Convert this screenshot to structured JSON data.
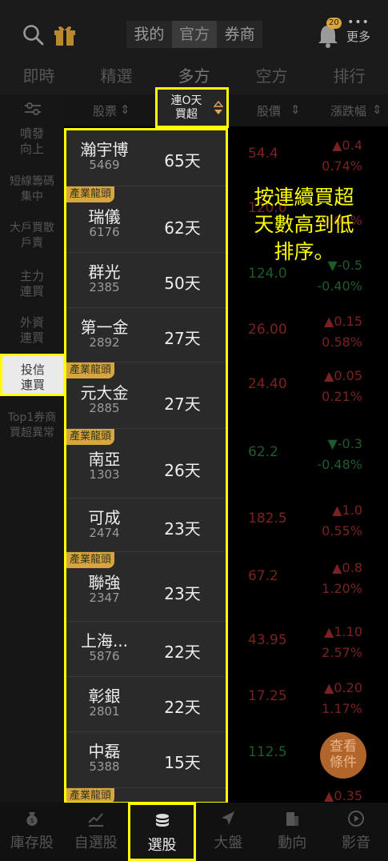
{
  "header": {
    "segments": [
      {
        "label": "我的",
        "active": false
      },
      {
        "label": "官方",
        "active": true
      },
      {
        "label": "券商",
        "active": false
      }
    ],
    "bell_badge": "20",
    "more_label": "更多"
  },
  "tabs": [
    {
      "label": "即時",
      "active": false
    },
    {
      "label": "精選",
      "active": false
    },
    {
      "label": "多方",
      "active": true
    },
    {
      "label": "空方",
      "active": false
    },
    {
      "label": "排行",
      "active": false
    }
  ],
  "columns": {
    "stock": "股票",
    "price": "股價",
    "change": "漲跌幅"
  },
  "sort_button": {
    "line1": "連O天",
    "line2": "買超"
  },
  "sidebar": [
    {
      "label1": "噴發",
      "label2": "向上",
      "active": false
    },
    {
      "label1": "短線籌碼",
      "label2": "集中",
      "active": false
    },
    {
      "label1": "大戶買散",
      "label2": "戶賣",
      "active": false
    },
    {
      "label1": "主力",
      "label2": "連買",
      "active": false
    },
    {
      "label1": "外資",
      "label2": "連買",
      "active": false
    },
    {
      "label1": "投信",
      "label2": "連買",
      "active": true
    },
    {
      "label1": "Top1券商",
      "label2": "買超異常",
      "active": false
    }
  ],
  "popup_rows": [
    {
      "name": "瀚宇博",
      "code": "5469",
      "days": "65天",
      "tag": ""
    },
    {
      "name": "瑞儀",
      "code": "6176",
      "days": "62天",
      "tag": "產業龍頭"
    },
    {
      "name": "群光",
      "code": "2385",
      "days": "50天",
      "tag": ""
    },
    {
      "name": "第一金",
      "code": "2892",
      "days": "27天",
      "tag": ""
    },
    {
      "name": "元大金",
      "code": "2885",
      "days": "27天",
      "tag": "產業龍頭"
    },
    {
      "name": "南亞",
      "code": "1303",
      "days": "26天",
      "tag": "產業龍頭"
    },
    {
      "name": "可成",
      "code": "2474",
      "days": "23天",
      "tag": ""
    },
    {
      "name": "聯強",
      "code": "2347",
      "days": "23天",
      "tag": "產業龍頭"
    },
    {
      "name": "上海...",
      "code": "5876",
      "days": "22天",
      "tag": ""
    },
    {
      "name": "彰銀",
      "code": "2801",
      "days": "22天",
      "tag": ""
    },
    {
      "name": "中磊",
      "code": "5388",
      "days": "15天",
      "tag": ""
    },
    {
      "name": "",
      "code": "",
      "days": "",
      "tag": "產業龍頭"
    }
  ],
  "background_rows": [
    {
      "price": "54.4",
      "change1": "▲0.4",
      "change2": "0.74%",
      "dir": "up"
    },
    {
      "price": "120.0",
      "change1": "",
      "change2": "0.00%",
      "dir": "up"
    },
    {
      "price": "124.0",
      "change1": "▼-0.5",
      "change2": "-0.40%",
      "dir": "down"
    },
    {
      "price": "26.00",
      "change1": "▲0.15",
      "change2": "0.58%",
      "dir": "up"
    },
    {
      "price": "24.40",
      "change1": "▲0.05",
      "change2": "0.21%",
      "dir": "up"
    },
    {
      "price": "62.2",
      "change1": "▼-0.3",
      "change2": "-0.48%",
      "dir": "down"
    },
    {
      "price": "182.5",
      "change1": "▲1.0",
      "change2": "0.55%",
      "dir": "up"
    },
    {
      "price": "67.2",
      "change1": "▲0.8",
      "change2": "1.20%",
      "dir": "up"
    },
    {
      "price": "43.95",
      "change1": "▲1.10",
      "change2": "2.57%",
      "dir": "up"
    },
    {
      "price": "17.25",
      "change1": "▲0.20",
      "change2": "1.17%",
      "dir": "up"
    },
    {
      "price": "112.5",
      "change1": "",
      "change2": "",
      "dir": "down"
    },
    {
      "price": "",
      "change1": "▲0.35",
      "change2": "",
      "dir": "up"
    }
  ],
  "note": {
    "line1": "按連續買超",
    "line2": "天數高到低",
    "line3": "排序。"
  },
  "query_button": {
    "line1": "查看",
    "line2": "條件"
  },
  "bottom_nav": [
    {
      "label": "庫存股",
      "icon": "money-bag-icon",
      "active": false
    },
    {
      "label": "自選股",
      "icon": "chart-icon",
      "active": false
    },
    {
      "label": "選股",
      "icon": "coin-stack-icon",
      "active": true
    },
    {
      "label": "大盤",
      "icon": "arrow-icon",
      "active": false
    },
    {
      "label": "動向",
      "icon": "building-icon",
      "active": false
    },
    {
      "label": "影音",
      "icon": "play-icon",
      "active": false
    }
  ],
  "colors": {
    "up": "#7a2222",
    "down": "#1e5b2c",
    "highlight": "#ffff00",
    "tag": "#d9a53d"
  }
}
